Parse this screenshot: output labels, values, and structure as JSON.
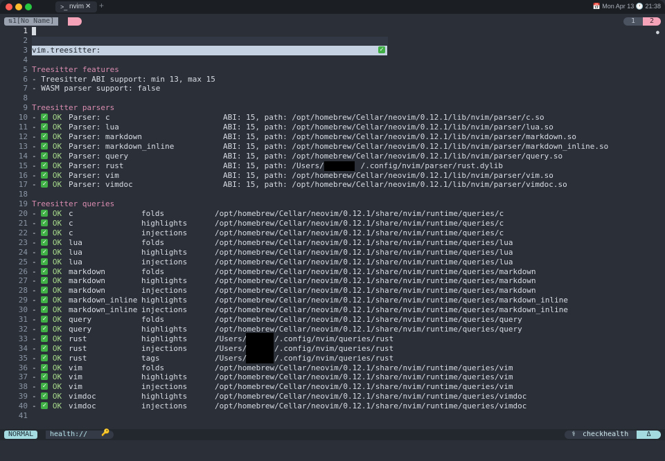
{
  "window": {
    "traffic_lights": [
      "#ff5f57",
      "#febc2e",
      "#28c840"
    ],
    "tab": {
      "prompt_icon": "terminal-icon",
      "prompt": ">_",
      "title": "nvim",
      "close": "✕"
    },
    "new_tab": "+",
    "datetime": "📅 Mon Apr 13  🕐 21:38"
  },
  "bufferline": {
    "name": "⇅1[No Name]",
    "tabs": [
      "1",
      "2"
    ]
  },
  "lines": [
    {
      "n": "1",
      "t": ""
    },
    {
      "n": "2",
      "t": ""
    },
    {
      "n": "3",
      "t": "vim.treesitter:"
    },
    {
      "n": "4",
      "t": ""
    },
    {
      "n": "5",
      "t": "Treesitter features"
    },
    {
      "n": "6",
      "t": "- Treesitter ABI support: min 13, max 15"
    },
    {
      "n": "7",
      "t": "- WASM parser support: false"
    },
    {
      "n": "8",
      "t": ""
    },
    {
      "n": "9",
      "t": "Treesitter parsers"
    },
    {
      "n": "10",
      "p": "Parser: c",
      "x": "ABI: 15, path: /opt/homebrew/Cellar/neovim/0.12.1/lib/nvim/parser/c.so"
    },
    {
      "n": "11",
      "p": "Parser: lua",
      "x": "ABI: 15, path: /opt/homebrew/Cellar/neovim/0.12.1/lib/nvim/parser/lua.so"
    },
    {
      "n": "12",
      "p": "Parser: markdown",
      "x": "ABI: 15, path: /opt/homebrew/Cellar/neovim/0.12.1/lib/nvim/parser/markdown.so"
    },
    {
      "n": "13",
      "p": "Parser: markdown_inline",
      "x": "ABI: 15, path: /opt/homebrew/Cellar/neovim/0.12.1/lib/nvim/parser/markdown_inline.so"
    },
    {
      "n": "14",
      "p": "Parser: query",
      "x": "ABI: 15, path: /opt/homebrew/Cellar/neovim/0.12.1/lib/nvim/parser/query.so"
    },
    {
      "n": "15",
      "p": "Parser: rust",
      "x": "ABI: 15, path: /Users/        /.config/nvim/parser/rust.dylib"
    },
    {
      "n": "16",
      "p": "Parser: vim",
      "x": "ABI: 15, path: /opt/homebrew/Cellar/neovim/0.12.1/lib/nvim/parser/vim.so"
    },
    {
      "n": "17",
      "p": "Parser: vimdoc",
      "x": "ABI: 15, path: /opt/homebrew/Cellar/neovim/0.12.1/lib/nvim/parser/vimdoc.so"
    },
    {
      "n": "18",
      "t": ""
    },
    {
      "n": "19",
      "t": "Treesitter queries"
    },
    {
      "n": "20",
      "q": "c",
      "k": "folds",
      "x": "/opt/homebrew/Cellar/neovim/0.12.1/share/nvim/runtime/queries/c"
    },
    {
      "n": "21",
      "q": "c",
      "k": "highlights",
      "x": "/opt/homebrew/Cellar/neovim/0.12.1/share/nvim/runtime/queries/c"
    },
    {
      "n": "22",
      "q": "c",
      "k": "injections",
      "x": "/opt/homebrew/Cellar/neovim/0.12.1/share/nvim/runtime/queries/c"
    },
    {
      "n": "23",
      "q": "lua",
      "k": "folds",
      "x": "/opt/homebrew/Cellar/neovim/0.12.1/share/nvim/runtime/queries/lua"
    },
    {
      "n": "24",
      "q": "lua",
      "k": "highlights",
      "x": "/opt/homebrew/Cellar/neovim/0.12.1/share/nvim/runtime/queries/lua"
    },
    {
      "n": "25",
      "q": "lua",
      "k": "injections",
      "x": "/opt/homebrew/Cellar/neovim/0.12.1/share/nvim/runtime/queries/lua"
    },
    {
      "n": "26",
      "q": "markdown",
      "k": "folds",
      "x": "/opt/homebrew/Cellar/neovim/0.12.1/share/nvim/runtime/queries/markdown"
    },
    {
      "n": "27",
      "q": "markdown",
      "k": "highlights",
      "x": "/opt/homebrew/Cellar/neovim/0.12.1/share/nvim/runtime/queries/markdown"
    },
    {
      "n": "28",
      "q": "markdown",
      "k": "injections",
      "x": "/opt/homebrew/Cellar/neovim/0.12.1/share/nvim/runtime/queries/markdown"
    },
    {
      "n": "29",
      "q": "markdown_inline",
      "k": "highlights",
      "x": "/opt/homebrew/Cellar/neovim/0.12.1/share/nvim/runtime/queries/markdown_inline"
    },
    {
      "n": "30",
      "q": "markdown_inline",
      "k": "injections",
      "x": "/opt/homebrew/Cellar/neovim/0.12.1/share/nvim/runtime/queries/markdown_inline"
    },
    {
      "n": "31",
      "q": "query",
      "k": "folds",
      "x": "/opt/homebrew/Cellar/neovim/0.12.1/share/nvim/runtime/queries/query"
    },
    {
      "n": "32",
      "q": "query",
      "k": "highlights",
      "x": "/opt/homebrew/Cellar/neovim/0.12.1/share/nvim/runtime/queries/query"
    },
    {
      "n": "33",
      "q": "rust",
      "k": "highlights",
      "x": "/Users/      /.config/nvim/queries/rust"
    },
    {
      "n": "34",
      "q": "rust",
      "k": "injections",
      "x": "/Users/      /.config/nvim/queries/rust"
    },
    {
      "n": "35",
      "q": "rust",
      "k": "tags",
      "x": "/Users/      /.config/nvim/queries/rust"
    },
    {
      "n": "36",
      "q": "vim",
      "k": "folds",
      "x": "/opt/homebrew/Cellar/neovim/0.12.1/share/nvim/runtime/queries/vim"
    },
    {
      "n": "37",
      "q": "vim",
      "k": "highlights",
      "x": "/opt/homebrew/Cellar/neovim/0.12.1/share/nvim/runtime/queries/vim"
    },
    {
      "n": "38",
      "q": "vim",
      "k": "injections",
      "x": "/opt/homebrew/Cellar/neovim/0.12.1/share/nvim/runtime/queries/vim"
    },
    {
      "n": "39",
      "q": "vimdoc",
      "k": "highlights",
      "x": "/opt/homebrew/Cellar/neovim/0.12.1/share/nvim/runtime/queries/vimdoc"
    },
    {
      "n": "40",
      "q": "vimdoc",
      "k": "injections",
      "x": "/opt/homebrew/Cellar/neovim/0.12.1/share/nvim/runtime/queries/vimdoc"
    },
    {
      "n": "41",
      "t": ""
    }
  ],
  "ok_label": "OK",
  "statusline": {
    "mode": "NORMAL",
    "file": "health://",
    "key_icon": "🔑",
    "plugin_icon": "stethoscope-icon",
    "plugin": "checkhealth",
    "right": "Δ"
  }
}
